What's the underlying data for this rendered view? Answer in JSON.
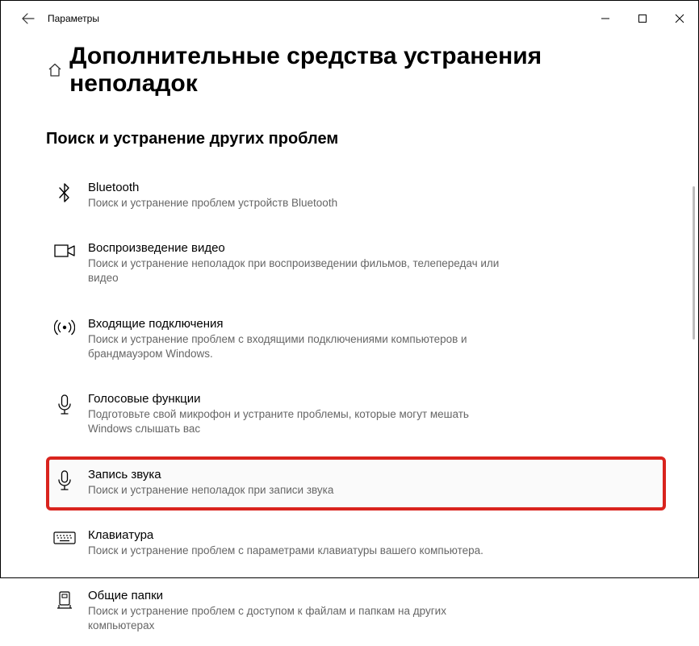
{
  "titlebar": {
    "app": "Параметры"
  },
  "page": {
    "title": "Дополнительные средства устранения неполадок"
  },
  "section": {
    "heading": "Поиск и устранение других проблем"
  },
  "items": [
    {
      "title": "Bluetooth",
      "desc": "Поиск и устранение проблем устройств Bluetooth"
    },
    {
      "title": "Воспроизведение видео",
      "desc": "Поиск и устранение неполадок при воспроизведении фильмов, телепередач или видео"
    },
    {
      "title": "Входящие подключения",
      "desc": "Поиск и устранение проблем с входящими подключениями компьютеров и брандмауэром Windows."
    },
    {
      "title": "Голосовые функции",
      "desc": "Подготовьте свой микрофон и устраните проблемы, которые могут мешать Windows слышать вас"
    },
    {
      "title": "Запись звука",
      "desc": "Поиск и устранение неполадок при записи звука"
    },
    {
      "title": "Клавиатура",
      "desc": "Поиск и устранение проблем с параметрами клавиатуры вашего компьютера."
    },
    {
      "title": "Общие папки",
      "desc": "Поиск и устранение проблем с доступом к файлам и папкам на других компьютерах"
    }
  ]
}
